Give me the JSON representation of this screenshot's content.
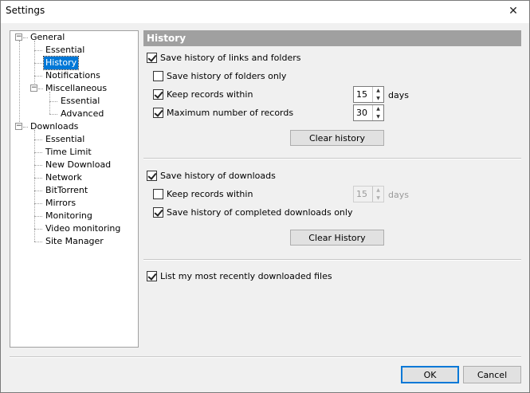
{
  "window": {
    "title": "Settings",
    "close_glyph": "✕"
  },
  "tree": {
    "items": [
      {
        "label": "General",
        "name": "tree-item-general",
        "expander": "−"
      },
      {
        "label": "Essential",
        "name": "tree-item-general-essential"
      },
      {
        "label": "History",
        "name": "tree-item-history",
        "selected": true
      },
      {
        "label": "Notifications",
        "name": "tree-item-notifications"
      },
      {
        "label": "Miscellaneous",
        "name": "tree-item-miscellaneous",
        "expander": "−"
      },
      {
        "label": "Essential",
        "name": "tree-item-misc-essential"
      },
      {
        "label": "Advanced",
        "name": "tree-item-misc-advanced"
      },
      {
        "label": "Downloads",
        "name": "tree-item-downloads",
        "expander": "−"
      },
      {
        "label": "Essential",
        "name": "tree-item-downloads-essential"
      },
      {
        "label": "Time Limit",
        "name": "tree-item-time-limit"
      },
      {
        "label": "New Download",
        "name": "tree-item-new-download"
      },
      {
        "label": "Network",
        "name": "tree-item-network"
      },
      {
        "label": "BitTorrent",
        "name": "tree-item-bittorrent"
      },
      {
        "label": "Mirrors",
        "name": "tree-item-mirrors"
      },
      {
        "label": "Monitoring",
        "name": "tree-item-monitoring"
      },
      {
        "label": "Video monitoring",
        "name": "tree-item-video-monitoring"
      },
      {
        "label": "Site Manager",
        "name": "tree-item-site-manager"
      }
    ]
  },
  "history": {
    "header": "History",
    "links": {
      "save_label": "Save history of links and folders",
      "save_checked": true,
      "folders_only_label": "Save history of folders only",
      "folders_only_checked": false,
      "keep_label": "Keep records within",
      "keep_checked": true,
      "keep_days": "15",
      "keep_unit": "days",
      "max_label": "Maximum number of records",
      "max_checked": true,
      "max_records": "30",
      "clear_button": "Clear history"
    },
    "downloads": {
      "save_label": "Save history of downloads",
      "save_checked": true,
      "keep_label": "Keep records within",
      "keep_checked": false,
      "keep_days": "15",
      "keep_unit": "days",
      "completed_label": "Save history of completed downloads only",
      "completed_checked": true,
      "clear_button": "Clear History"
    },
    "recent": {
      "label": "List my most recently downloaded files",
      "checked": true
    }
  },
  "footer": {
    "ok": "OK",
    "cancel": "Cancel"
  }
}
